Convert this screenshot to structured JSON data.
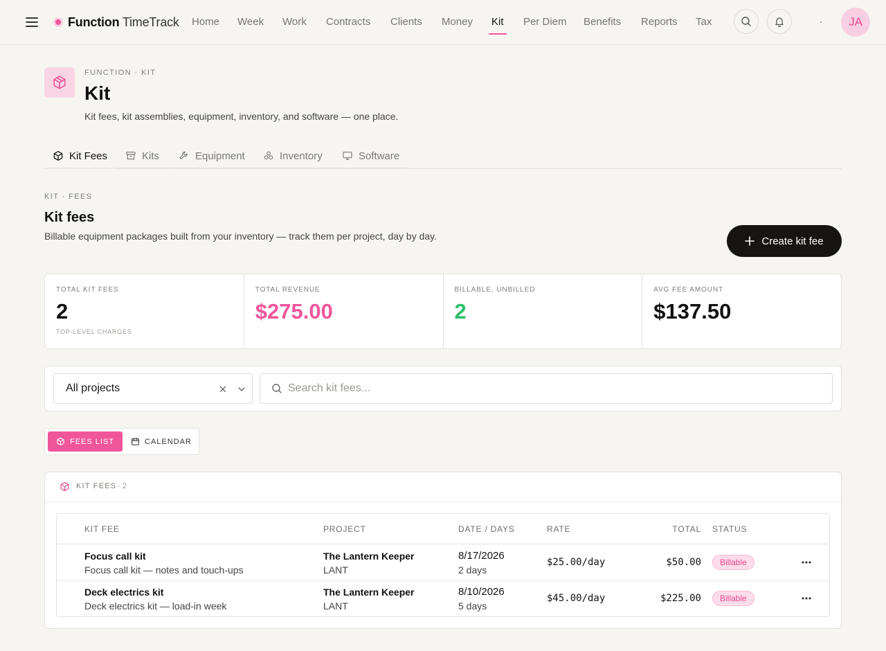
{
  "app": {
    "brand_bold": "Function",
    "brand_rest": " TimeTrack",
    "accent": "#f1569b"
  },
  "nav": {
    "items": [
      {
        "label": "Home"
      },
      {
        "label": "Week"
      },
      {
        "label": "Work"
      },
      {
        "label": "Contracts"
      },
      {
        "label": "Clients"
      },
      {
        "label": "Money"
      },
      {
        "label": "Kit",
        "active": true
      },
      {
        "label": "Per Diem"
      },
      {
        "label": "Benefits"
      },
      {
        "label": "Reports"
      },
      {
        "label": "Tax"
      }
    ],
    "avatar_initials": "JA"
  },
  "page": {
    "eyebrow": "FUNCTION · KIT",
    "title": "Kit",
    "subtitle": "Kit fees, kit assemblies, equipment, inventory, and software — one place."
  },
  "subtabs": [
    {
      "label": "Kit Fees",
      "icon": "cube-icon",
      "active": true
    },
    {
      "label": "Kits",
      "icon": "archive-icon"
    },
    {
      "label": "Equipment",
      "icon": "wrench-icon"
    },
    {
      "label": "Inventory",
      "icon": "boxes-icon"
    },
    {
      "label": "Software",
      "icon": "monitor-icon"
    }
  ],
  "section": {
    "eyebrow": "KIT · FEES",
    "title": "Kit fees",
    "description": "Billable equipment packages built from your inventory — track them per project, day by day.",
    "create_label": "Create kit fee"
  },
  "stats": [
    {
      "label": "TOTAL KIT FEES",
      "value": "2",
      "foot": "TOP-LEVEL CHARGES",
      "color": "#111111"
    },
    {
      "label": "TOTAL REVENUE",
      "value": "$275.00",
      "foot": "",
      "color": "#f1569b"
    },
    {
      "label": "BILLABLE, UNBILLED",
      "value": "2",
      "foot": "",
      "color": "#2fbf6a"
    },
    {
      "label": "AVG FEE AMOUNT",
      "value": "$137.50",
      "foot": "",
      "color": "#111111"
    }
  ],
  "filters": {
    "project_value": "All projects",
    "search_placeholder": "Search kit fees..."
  },
  "view_toggle": {
    "list_label": "FEES LIST",
    "calendar_label": "CALENDAR"
  },
  "table": {
    "card_label": "KIT FEES",
    "card_count": "· 2",
    "headers": {
      "fee": "KIT FEE",
      "project": "PROJECT",
      "date": "DATE / DAYS",
      "rate": "RATE",
      "total": "TOTAL",
      "status": "STATUS"
    },
    "rows": [
      {
        "name": "Focus call kit",
        "desc": "Focus call kit — notes and touch-ups",
        "project": "The Lantern Keeper",
        "project_code": "LANT",
        "date": "8/17/2026",
        "days": "2 days",
        "rate": "$25.00/day",
        "total": "$50.00",
        "status": "Billable"
      },
      {
        "name": "Deck electrics kit",
        "desc": "Deck electrics kit — load-in week",
        "project": "The Lantern Keeper",
        "project_code": "LANT",
        "date": "8/10/2026",
        "days": "5 days",
        "rate": "$45.00/day",
        "total": "$225.00",
        "status": "Billable"
      }
    ]
  }
}
